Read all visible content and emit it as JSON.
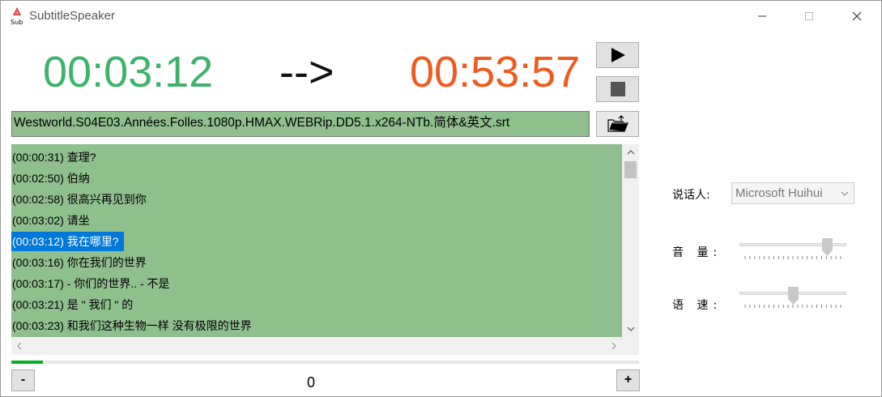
{
  "window": {
    "title": "SubtitleSpeaker",
    "icon_text": "Sub"
  },
  "player": {
    "current_time": "00:03:12",
    "arrow": "-->",
    "total_time": "00:53:57",
    "current_color": "#3cb36a",
    "total_color": "#f05a1e"
  },
  "file": {
    "name": "Westworld.S04E03.Années.Folles.1080p.HMAX.WEBRip.DD5.1.x264-NTb.简体&英文.srt"
  },
  "subtitles": [
    {
      "time": "(00:00:31)",
      "text": "查理?"
    },
    {
      "time": "(00:02:50)",
      "text": "伯纳"
    },
    {
      "time": "(00:02:58)",
      "text": "很高兴再见到你"
    },
    {
      "time": "(00:03:02)",
      "text": "请坐"
    },
    {
      "time": "(00:03:12)",
      "text": "我在哪里?"
    },
    {
      "time": "(00:03:16)",
      "text": "你在我们的世界"
    },
    {
      "time": "(00:03:17)",
      "text": " - 你们的世界.. - 不是"
    },
    {
      "time": "(00:03:21)",
      "text": "是 \" 我们 \" 的"
    },
    {
      "time": "(00:03:23)",
      "text": "和我们这种生物一样 没有极限的世界"
    }
  ],
  "selected_index": 4,
  "list_background": "#8fbf8c",
  "selection_color": "#0078d7",
  "progress": 0.05,
  "controls": {
    "minus": "-",
    "plus": "+",
    "counter": "0"
  },
  "voice": {
    "speaker_label": "说话人:",
    "speaker_value": "Microsoft Huihui",
    "volume_label": "音 量:",
    "rate_label": "语 速:",
    "volume_level": 0.85,
    "rate_level": 0.5
  }
}
